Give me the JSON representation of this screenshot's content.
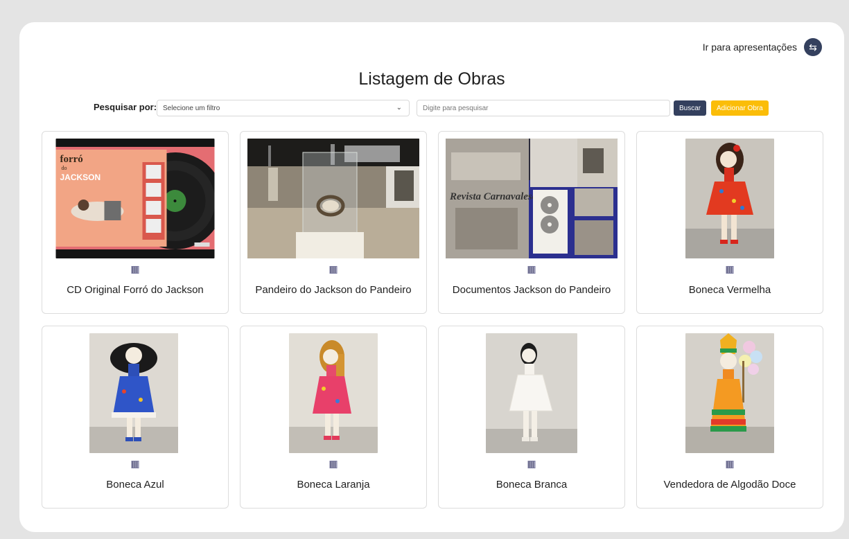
{
  "header": {
    "goto_label": "Ir para apresentações",
    "goto_icon": "swap-arrows-icon",
    "title": "Listagem de Obras"
  },
  "search": {
    "label": "Pesquisar por:",
    "filter_value": "Selecione um filtro",
    "input_placeholder": "Digite para pesquisar",
    "search_button": "Buscar",
    "add_button": "Adicionar Obra"
  },
  "colors": {
    "primary": "#34405e",
    "accent": "#fbbd08",
    "page_bg": "#e4e4e4"
  },
  "works": [
    {
      "title": "CD Original Forró do Jackson",
      "image": "vinyl-record-album-photo"
    },
    {
      "title": "Pandeiro do Jackson do Pandeiro",
      "image": "pandeiro-display-case-photo"
    },
    {
      "title": "Documentos Jackson do Pandeiro",
      "image": "newspaper-documents-photo"
    },
    {
      "title": "Boneca Vermelha",
      "image": "red-doll-photo"
    },
    {
      "title": "Boneca Azul",
      "image": "blue-doll-photo"
    },
    {
      "title": "Boneca Laranja",
      "image": "orange-doll-photo"
    },
    {
      "title": "Boneca Branca",
      "image": "white-doll-photo"
    },
    {
      "title": "Vendedora de Algodão Doce",
      "image": "cotton-candy-seller-doll-photo"
    }
  ],
  "album_cover": {
    "line1": "forró",
    "line2": "do",
    "line3": "JACKSON"
  },
  "newspaper": {
    "headline": "Revista Carnavalesca"
  }
}
